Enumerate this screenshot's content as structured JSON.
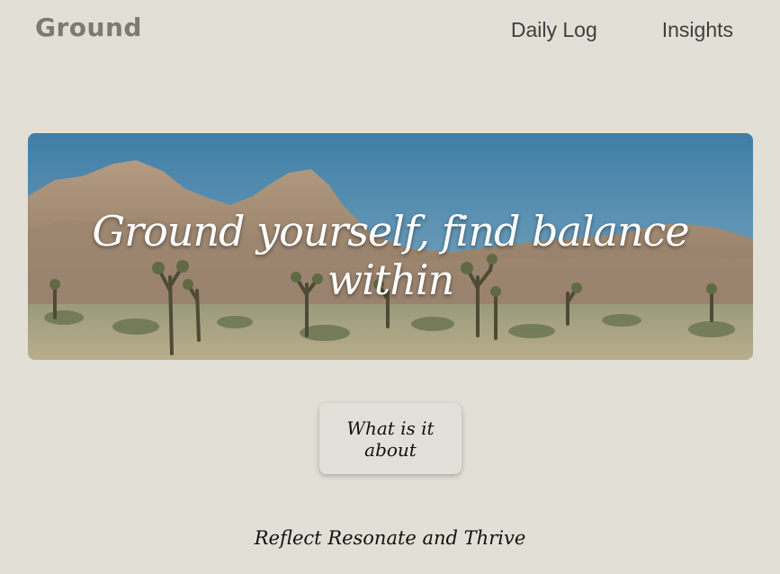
{
  "header": {
    "logo": "Ground",
    "nav": [
      {
        "label": "Daily Log"
      },
      {
        "label": "Insights"
      }
    ]
  },
  "hero": {
    "title": "Ground yourself, find balance within",
    "image": "desert-landscape-with-joshua-trees"
  },
  "about_button": {
    "label": "What is it about"
  },
  "tagline": "Reflect Resonate and Thrive",
  "colors": {
    "background": "#e2dfd6",
    "logo": "#7d7a72",
    "nav_text": "#3f3f3f",
    "sky": "#4f86aa",
    "rock": "#a48b72",
    "brush": "#a9a58a"
  }
}
